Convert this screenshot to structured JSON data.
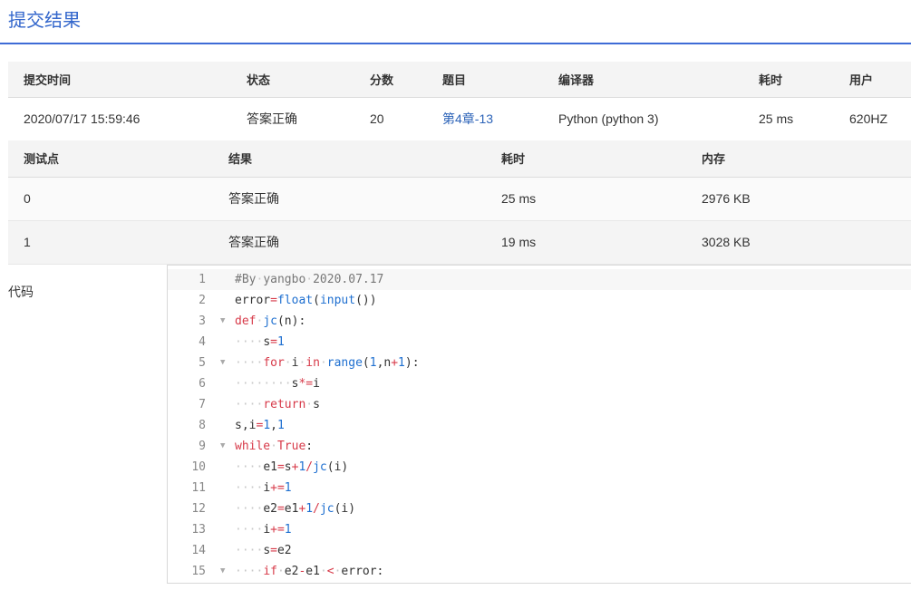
{
  "page": {
    "title": "提交结果"
  },
  "submission": {
    "headers": [
      "提交时间",
      "状态",
      "分数",
      "题目",
      "编译器",
      "耗时",
      "用户"
    ],
    "row": {
      "time": "2020/07/17 15:59:46",
      "status": "答案正确",
      "score": "20",
      "problem": "第4章-13",
      "compiler": "Python (python 3)",
      "duration": "25 ms",
      "user": "620HZ"
    }
  },
  "tests": {
    "headers": [
      "测试点",
      "结果",
      "耗时",
      "内存"
    ],
    "rows": [
      {
        "id": "0",
        "result": "答案正确",
        "duration": "25 ms",
        "memory": "2976 KB"
      },
      {
        "id": "1",
        "result": "答案正确",
        "duration": "19 ms",
        "memory": "3028 KB"
      }
    ]
  },
  "code": {
    "label": "代码",
    "line_numbers": [
      "1",
      "2",
      "3",
      "4",
      "5",
      "6",
      "7",
      "8",
      "9",
      "10",
      "11",
      "12",
      "13",
      "14",
      "15"
    ],
    "foldable_lines": [
      "3",
      "5",
      "9",
      "15"
    ],
    "lines": [
      "#By yangbo 2020.07.17",
      "error=float(input())",
      "def jc(n):",
      "    s=1",
      "    for i in range(1,n+1):",
      "        s*=i",
      "    return s",
      "s,i=1,1",
      "while True:",
      "    e1=s+1/jc(i)",
      "    i+=1",
      "    e2=e1+1/jc(i)",
      "    i+=1",
      "    s=e2",
      "    if e2-e1 < error:"
    ]
  },
  "colors": {
    "accent": "#3e6bd6",
    "status_ok": "#e5473a",
    "link": "#2c63b8"
  }
}
